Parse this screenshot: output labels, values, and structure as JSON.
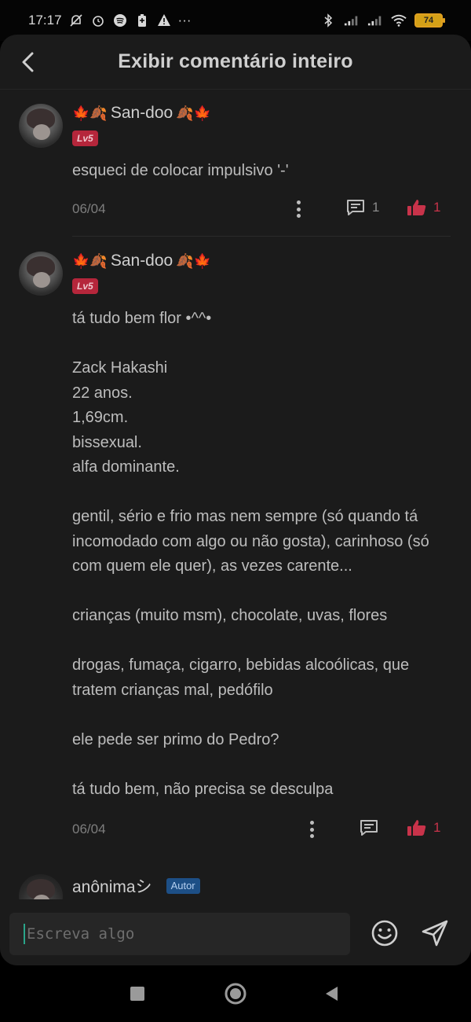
{
  "status_bar": {
    "time": "17:17",
    "battery": "74",
    "more": "···"
  },
  "header": {
    "title": "Exibir comentário inteiro"
  },
  "comments": [
    {
      "name": "San-doo",
      "leaves_left": "🍁🍂",
      "leaves_right": "🍂🍁",
      "level": "Lv5",
      "text": "esqueci de colocar impulsivo '-'",
      "date": "06/04",
      "reply_count": "1",
      "like_count": "1"
    },
    {
      "name": "San-doo",
      "leaves_left": "🍁🍂",
      "leaves_right": "🍂🍁",
      "level": "Lv5",
      "text": "tá tudo bem flor •^^•\n\nZack Hakashi\n22 anos.\n1,69cm.\nbissexual.\nalfa dominante.\n\ngentil, sério e frio mas nem sempre (só quando tá incomodado com algo ou não gosta), carinhoso (só com quem ele quer), as vezes carente...\n\ncrianças (muito msm), chocolate, uvas, flores\n\ndrogas, fumaça, cigarro, bebidas alcoólicas, que tratem crianças mal, pedófilo\n\nele pede ser primo do Pedro?\n\ntá tudo bem, não precisa se desculpa",
      "date": "06/04",
      "like_count": "1"
    },
    {
      "name": "anônimaシ",
      "badge": "Autor"
    }
  ],
  "input": {
    "placeholder": "Escreva algo"
  },
  "colors": {
    "like": "#c8334a",
    "level_badge": "#b5263b",
    "author_badge": "#1d4f86",
    "caret": "#2aa58a"
  }
}
